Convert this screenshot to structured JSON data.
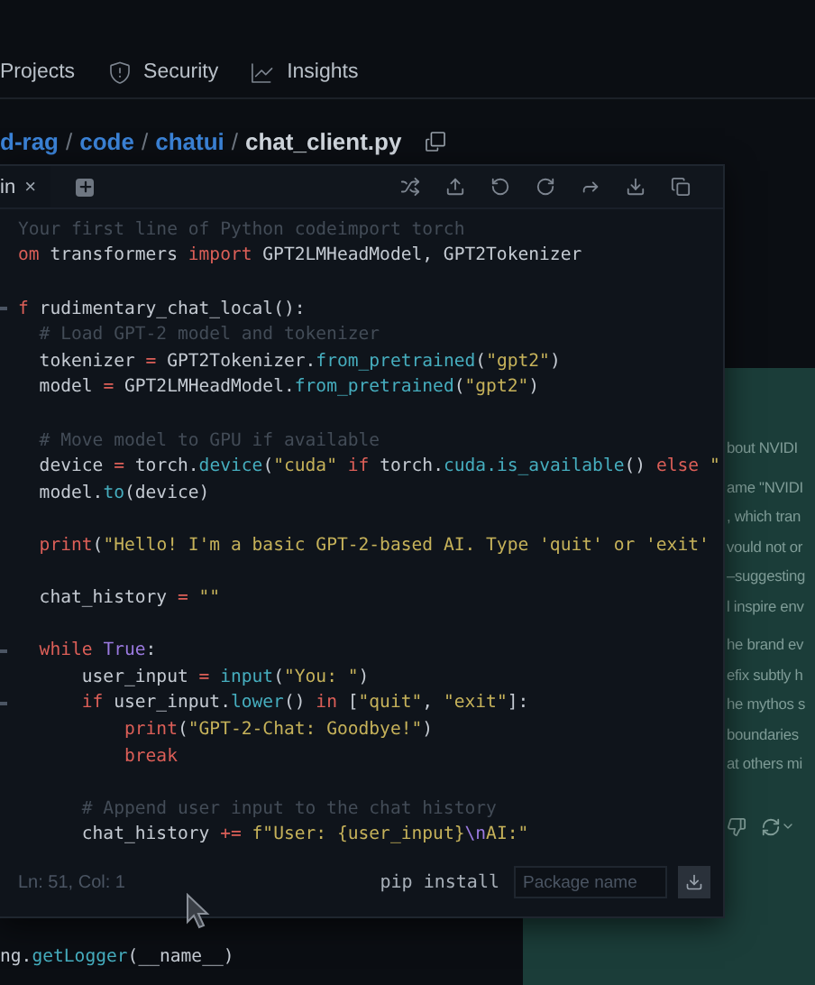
{
  "nav": {
    "items": [
      {
        "label": "Projects"
      },
      {
        "label": "Security"
      },
      {
        "label": "Insights"
      }
    ]
  },
  "breadcrumb": {
    "links": [
      "d-rag",
      "code",
      "chatui"
    ],
    "separator": "/",
    "current": "chat_client.py"
  },
  "editor": {
    "tab": {
      "label": "in",
      "close": "×"
    },
    "lines": [
      {
        "kind": "code",
        "tokens": [
          {
            "t": "Your first line of Python codeimport torch",
            "kind": "comment"
          }
        ]
      },
      {
        "kind": "code",
        "tokens": [
          {
            "t": "om",
            "kind": "keyword"
          },
          {
            "t": " transformers ",
            "kind": "plain"
          },
          {
            "t": "import",
            "kind": "keyword"
          },
          {
            "t": " GPT2LMHeadModel, GPT2Tokenizer",
            "kind": "plain"
          }
        ]
      },
      {
        "kind": "blank"
      },
      {
        "kind": "code",
        "fold": true,
        "tokens": [
          {
            "t": "f",
            "kind": "keyword"
          },
          {
            "t": " rudimentary_chat_local():",
            "kind": "plain"
          }
        ]
      },
      {
        "kind": "code",
        "tokens": [
          {
            "t": "  # Load GPT-2 model and tokenizer",
            "kind": "comment"
          }
        ]
      },
      {
        "kind": "code",
        "tokens": [
          {
            "t": "  tokenizer ",
            "kind": "plain"
          },
          {
            "t": "=",
            "kind": "keyword"
          },
          {
            "t": " GPT2Tokenizer.",
            "kind": "plain"
          },
          {
            "t": "from_pretrained",
            "kind": "function"
          },
          {
            "t": "(",
            "kind": "plain"
          },
          {
            "t": "\"gpt2\"",
            "kind": "string"
          },
          {
            "t": ")",
            "kind": "plain"
          }
        ]
      },
      {
        "kind": "code",
        "tokens": [
          {
            "t": "  model ",
            "kind": "plain"
          },
          {
            "t": "=",
            "kind": "keyword"
          },
          {
            "t": " GPT2LMHeadModel.",
            "kind": "plain"
          },
          {
            "t": "from_pretrained",
            "kind": "function"
          },
          {
            "t": "(",
            "kind": "plain"
          },
          {
            "t": "\"gpt2\"",
            "kind": "string"
          },
          {
            "t": ")",
            "kind": "plain"
          }
        ]
      },
      {
        "kind": "blank"
      },
      {
        "kind": "code",
        "tokens": [
          {
            "t": "  # Move model to GPU if available",
            "kind": "comment"
          }
        ]
      },
      {
        "kind": "code",
        "tokens": [
          {
            "t": "  device ",
            "kind": "plain"
          },
          {
            "t": "=",
            "kind": "keyword"
          },
          {
            "t": " torch.",
            "kind": "plain"
          },
          {
            "t": "device",
            "kind": "function"
          },
          {
            "t": "(",
            "kind": "plain"
          },
          {
            "t": "\"cuda\" ",
            "kind": "string"
          },
          {
            "t": "if",
            "kind": "keyword"
          },
          {
            "t": " torch.",
            "kind": "plain"
          },
          {
            "t": "cuda.is_available",
            "kind": "function"
          },
          {
            "t": "() ",
            "kind": "plain"
          },
          {
            "t": "else",
            "kind": "keyword"
          },
          {
            "t": " \"",
            "kind": "string"
          }
        ]
      },
      {
        "kind": "code",
        "tokens": [
          {
            "t": "  model.",
            "kind": "plain"
          },
          {
            "t": "to",
            "kind": "function"
          },
          {
            "t": "(device)",
            "kind": "plain"
          }
        ]
      },
      {
        "kind": "blank"
      },
      {
        "kind": "code",
        "tokens": [
          {
            "t": "  print",
            "kind": "keyword"
          },
          {
            "t": "(",
            "kind": "plain"
          },
          {
            "t": "\"Hello! I'm a basic GPT-2-based AI. Type 'quit' or 'exit'",
            "kind": "string"
          }
        ]
      },
      {
        "kind": "blank"
      },
      {
        "kind": "code",
        "tokens": [
          {
            "t": "  chat_history ",
            "kind": "plain"
          },
          {
            "t": "=",
            "kind": "keyword"
          },
          {
            "t": " \"\"",
            "kind": "string"
          }
        ]
      },
      {
        "kind": "blank"
      },
      {
        "kind": "code",
        "fold": true,
        "tokens": [
          {
            "t": "  while",
            "kind": "keyword"
          },
          {
            "t": " True",
            "kind": "constant"
          },
          {
            "t": ":",
            "kind": "plain"
          }
        ]
      },
      {
        "kind": "code",
        "tokens": [
          {
            "t": "      user_input ",
            "kind": "plain"
          },
          {
            "t": "=",
            "kind": "keyword"
          },
          {
            "t": " input",
            "kind": "function"
          },
          {
            "t": "(",
            "kind": "plain"
          },
          {
            "t": "\"You: \"",
            "kind": "string"
          },
          {
            "t": ")",
            "kind": "plain"
          }
        ]
      },
      {
        "kind": "code",
        "fold": true,
        "tokens": [
          {
            "t": "      if",
            "kind": "keyword"
          },
          {
            "t": " user_input.",
            "kind": "plain"
          },
          {
            "t": "lower",
            "kind": "function"
          },
          {
            "t": "() ",
            "kind": "plain"
          },
          {
            "t": "in",
            "kind": "keyword"
          },
          {
            "t": " [",
            "kind": "plain"
          },
          {
            "t": "\"quit\"",
            "kind": "string"
          },
          {
            "t": ", ",
            "kind": "plain"
          },
          {
            "t": "\"exit\"",
            "kind": "string"
          },
          {
            "t": "]:",
            "kind": "plain"
          }
        ]
      },
      {
        "kind": "code",
        "tokens": [
          {
            "t": "          print",
            "kind": "keyword"
          },
          {
            "t": "(",
            "kind": "plain"
          },
          {
            "t": "\"GPT-2-Chat: Goodbye!\"",
            "kind": "string"
          },
          {
            "t": ")",
            "kind": "plain"
          }
        ]
      },
      {
        "kind": "code",
        "tokens": [
          {
            "t": "          break",
            "kind": "keyword"
          }
        ]
      },
      {
        "kind": "blank"
      },
      {
        "kind": "code",
        "tokens": [
          {
            "t": "      # Append user input to the chat history",
            "kind": "comment"
          }
        ]
      },
      {
        "kind": "code",
        "tokens": [
          {
            "t": "      chat_history ",
            "kind": "plain"
          },
          {
            "t": "+=",
            "kind": "keyword"
          },
          {
            "t": " f\"User: {user_input}",
            "kind": "string"
          },
          {
            "t": "\\n",
            "kind": "constant"
          },
          {
            "t": "AI:\"",
            "kind": "string"
          }
        ]
      }
    ],
    "status": "Ln: 51, Col: 1",
    "pip_label": "pip install",
    "package_field": {
      "placeholder": "Package name"
    }
  },
  "background_code": [
    {
      "t": "ng.",
      "kind": "plain"
    },
    {
      "t": "getLogger",
      "kind": "function"
    },
    {
      "t": "(__name__)",
      "kind": "plain"
    }
  ],
  "chat": {
    "paragraphs": [
      [
        "bout NVIDI"
      ],
      [
        "ame \"NVIDI",
        ", which tran",
        "vould not or",
        "–suggesting",
        "l inspire env"
      ],
      [
        "he brand ev",
        "efix subtly h",
        "he mythos s",
        "boundaries",
        "at others mi"
      ]
    ]
  }
}
